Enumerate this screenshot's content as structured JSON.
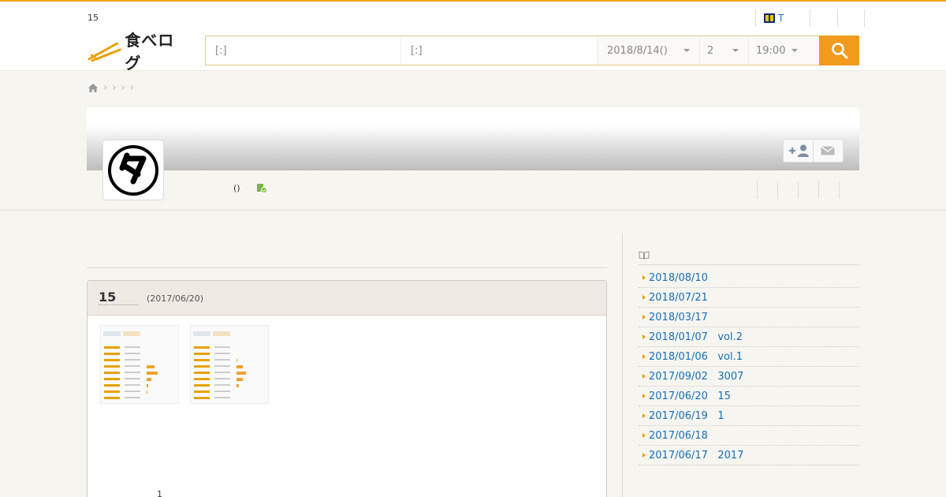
{
  "header": {
    "count_label": "15",
    "tpoint_label": "T",
    "logo_text": "食べログ"
  },
  "search": {
    "area_placeholder": "[:]",
    "keyword_placeholder": "[:]",
    "date": "2018/8/14()",
    "people": "2",
    "time": "19:00"
  },
  "profile": {
    "info_paren": "()"
  },
  "review": {
    "title": "15",
    "date": "(2017/06/20)",
    "footer_num": "1"
  },
  "sidebar": {
    "items": [
      "2018/08/10",
      "2018/07/21",
      "2018/03/17",
      "2018/01/07   vol.2",
      "2018/01/06   vol.1",
      "2017/09/02   3007",
      "2017/06/20   15",
      "2017/06/19   1",
      "2017/06/18",
      "2017/06/17   2017"
    ]
  },
  "colors": {
    "accent": "#f29a1e",
    "link": "#1a6fb5",
    "top_border": "#f0a400"
  },
  "icons": {
    "search": "search-icon",
    "home": "home-icon",
    "follow": "add-user-icon",
    "message": "envelope-icon",
    "book": "book-icon",
    "verified": "verified-icon"
  }
}
